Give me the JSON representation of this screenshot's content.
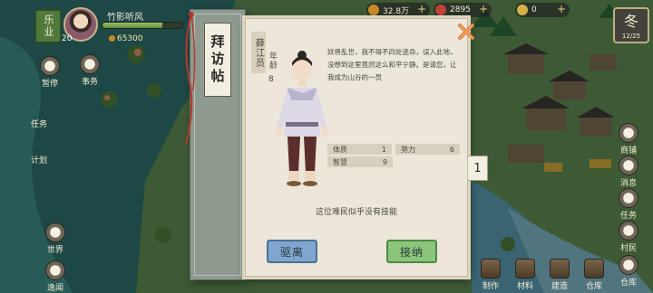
{
  "hud": {
    "region_label": "乐业",
    "level": "20",
    "player_name": "竹影听风",
    "xp_fraction": 0.75,
    "coins": "65300",
    "resources": [
      {
        "value": "32.8万",
        "icon": "copper-coin-icon",
        "color": "#c88a26"
      },
      {
        "value": "2895",
        "icon": "red-jade-icon",
        "color": "#c2413a"
      },
      {
        "value": "0",
        "icon": "gold-ingot-icon",
        "color": "#d4b24a"
      }
    ],
    "season": "冬",
    "season_date": "12/25"
  },
  "side_menu": {
    "left": [
      "暂停",
      "事务",
      "任务",
      "计划",
      "世界",
      "逸闻"
    ],
    "right": [
      "商铺",
      "消息",
      "任务",
      "村民",
      "仓库"
    ]
  },
  "bottom_menu": [
    "制作",
    "材料",
    "建造",
    "仓库"
  ],
  "dialog": {
    "flap_title": "拜访帖",
    "name": "薛江员",
    "age_label": "年龄",
    "age": "8",
    "bio": "妖兽乱世，我不得不四处逃命，误入此地，没想到这里竟然这么和平宁静。是请您，让我成为山谷的一员",
    "stats": [
      {
        "label": "体质",
        "value": "1"
      },
      {
        "label": "勢力",
        "value": "6"
      },
      {
        "label": "智慧",
        "value": "9"
      }
    ],
    "note": "这位难民似乎没有技能",
    "expel_label": "驱离",
    "accept_label": "接纳",
    "page_number": "1"
  }
}
